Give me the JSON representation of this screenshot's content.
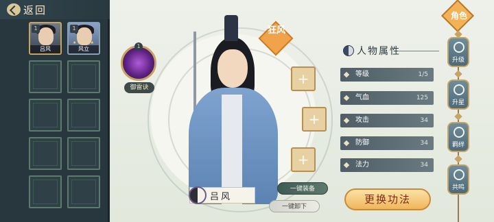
{
  "header": {
    "back_label": "返回"
  },
  "roster": {
    "heroes": [
      {
        "name": "吕风",
        "level": "1"
      },
      {
        "name": "风立",
        "level": "1",
        "stars": "★★★★★"
      }
    ],
    "empty_slot_count": 8
  },
  "skill": {
    "name": "御雷诀",
    "level": "1"
  },
  "character": {
    "name": "吕风",
    "element_banner": "狂风"
  },
  "buttons": {
    "equip_all": "一键装备",
    "unequip_all": "一键卸下",
    "change_skill": "更换功法"
  },
  "attributes": {
    "title": "人物属性",
    "rows": [
      {
        "label": "等级",
        "value": "1/5"
      },
      {
        "label": "气血",
        "value": "125"
      },
      {
        "label": "攻击",
        "value": "34"
      },
      {
        "label": "防御",
        "value": "34"
      },
      {
        "label": "法力",
        "value": "34"
      }
    ]
  },
  "side_tabs": {
    "role": "角色",
    "items": [
      "升级",
      "升星",
      "羁绊",
      "共鸣"
    ]
  },
  "colors": {
    "panel_dark": "#28363d",
    "gold_accent": "#c7a463",
    "orange_button": "#f0b65b"
  },
  "icons": {
    "back": "back-arrow-icon",
    "skill": "lightning-skill-icon",
    "element": "yin-yang-icon",
    "attributes": "yin-yang-icon",
    "equip_slot": "plus-icon"
  }
}
